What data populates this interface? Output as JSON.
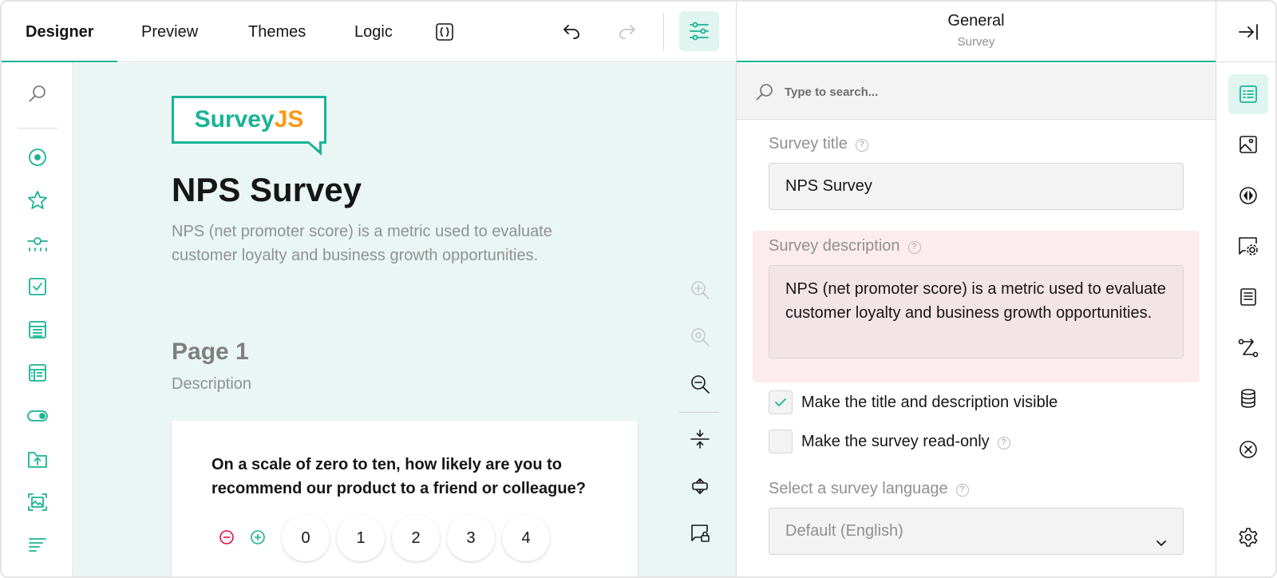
{
  "toolbar": {
    "tabs": [
      {
        "label": "Designer",
        "active": true
      },
      {
        "label": "Preview",
        "active": false
      },
      {
        "label": "Themes",
        "active": false
      },
      {
        "label": "Logic",
        "active": false
      }
    ],
    "json_icon": "json-editor-icon",
    "undo_icon": "undo-icon",
    "redo_icon": "redo-icon",
    "settings_icon": "settings-sliders-icon"
  },
  "toolbox": {
    "items": [
      "search-icon",
      "radiogroup-icon",
      "rating-icon",
      "slider-icon",
      "checkbox-icon",
      "dropdown-icon",
      "matrix-icon",
      "boolean-icon",
      "file-upload-icon",
      "image-picker-icon",
      "text-icon"
    ]
  },
  "canvas": {
    "logo": {
      "part1": "Survey",
      "part2": "JS"
    },
    "title": "NPS Survey",
    "description": "NPS (net promoter score) is a metric used to evaluate customer loyalty and business growth opportunities.",
    "page": {
      "title": "Page 1",
      "description": "Description"
    },
    "question": {
      "title": "On a scale of zero to ten, how likely are you to recommend our product to a friend or colleague?",
      "rates": [
        "0",
        "1",
        "2",
        "3",
        "4"
      ]
    },
    "zoom_icons": [
      "zoom-in-icon",
      "zoom-reset-icon",
      "zoom-out-icon",
      "collapse-icon",
      "expand-icon",
      "lock-icon"
    ]
  },
  "property_grid": {
    "title": "General",
    "subtitle": "Survey",
    "search_placeholder": "Type to search...",
    "survey_title_label": "Survey title",
    "survey_title_value": "NPS Survey",
    "survey_description_label": "Survey description",
    "survey_description_value": "NPS (net promoter score) is a metric used to evaluate customer loyalty and business growth opportunities.",
    "checkbox_visible_label": "Make the title and description visible",
    "checkbox_visible_checked": true,
    "checkbox_readonly_label": "Make the survey read-only",
    "checkbox_readonly_checked": false,
    "language_label": "Select a survey language",
    "language_value": "Default (English)",
    "help_glyph": "?"
  },
  "right_sidebar": {
    "icons": [
      "collapse-panel-icon",
      "general-icon",
      "logo-image-icon",
      "navigation-icon",
      "question-settings-icon",
      "pages-icon",
      "logic-icon",
      "data-icon",
      "validation-icon",
      "settings-gear-icon"
    ]
  },
  "colors": {
    "accent": "#19b394",
    "accent_light": "#e0f5ef",
    "logo_orange": "#ff9814",
    "error_bg": "#fdeced",
    "minus_red": "#e60a3e"
  }
}
